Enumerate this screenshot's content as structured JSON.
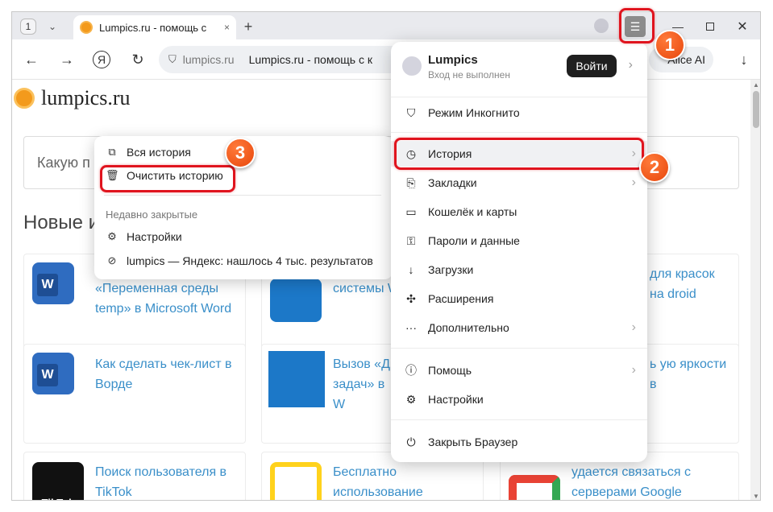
{
  "browser": {
    "tab_count": "1",
    "tab_title": "Lumpics.ru - помощь с",
    "close_tab": "×",
    "new_tab": "+",
    "menu_glyph": "☰",
    "minimize": "—",
    "close": "✕"
  },
  "toolbar": {
    "back": "←",
    "forward": "→",
    "yandex": "Я",
    "reload": "↻",
    "domain": "lumpics.ru",
    "page_title": "Lumpics.ru - помощь с к",
    "ai_label": "Alice AI",
    "download": "↓"
  },
  "page": {
    "logo_text": "lumpics.ru",
    "search_placeholder": "Какую п",
    "section_title": "Новые и",
    "cards": [
      {
        "title": "«Переменная среды temp» в Microsoft Word"
      },
      {
        "title": "системы W"
      },
      {
        "title": "для красок на droid"
      },
      {
        "title": "Как сделать чек-лист в Ворде"
      },
      {
        "title": "Вызов «Ди задач» в W"
      },
      {
        "title": "ь ую яркости в"
      },
      {
        "title": "Поиск пользователя в TikTok"
      },
      {
        "title": "Бесплатно использование Яндекс Музыки"
      },
      {
        "title": "удается связаться с серверами Google"
      }
    ],
    "tiktok_label": "TikTok",
    "word_letter": "W"
  },
  "history_menu": {
    "all_history": "Вся история",
    "clear_history": "Очистить историю",
    "recently_closed": "Недавно закрытые",
    "recent_items": [
      "Настройки",
      "lumpics — Яндекс: нашлось 4 тыс. результатов"
    ]
  },
  "main_menu": {
    "account_name": "Lumpics",
    "account_status": "Вход не выполнен",
    "login": "Войти",
    "items": [
      "Режим Инкогнито",
      "История",
      "Закладки",
      "Кошелёк и карты",
      "Пароли и данные",
      "Загрузки",
      "Расширения",
      "Дополнительно",
      "Помощь",
      "Настройки",
      "Закрыть Браузер"
    ]
  },
  "annotations": {
    "step1": "1",
    "step2": "2",
    "step3": "3",
    "color": "#e0141e"
  }
}
